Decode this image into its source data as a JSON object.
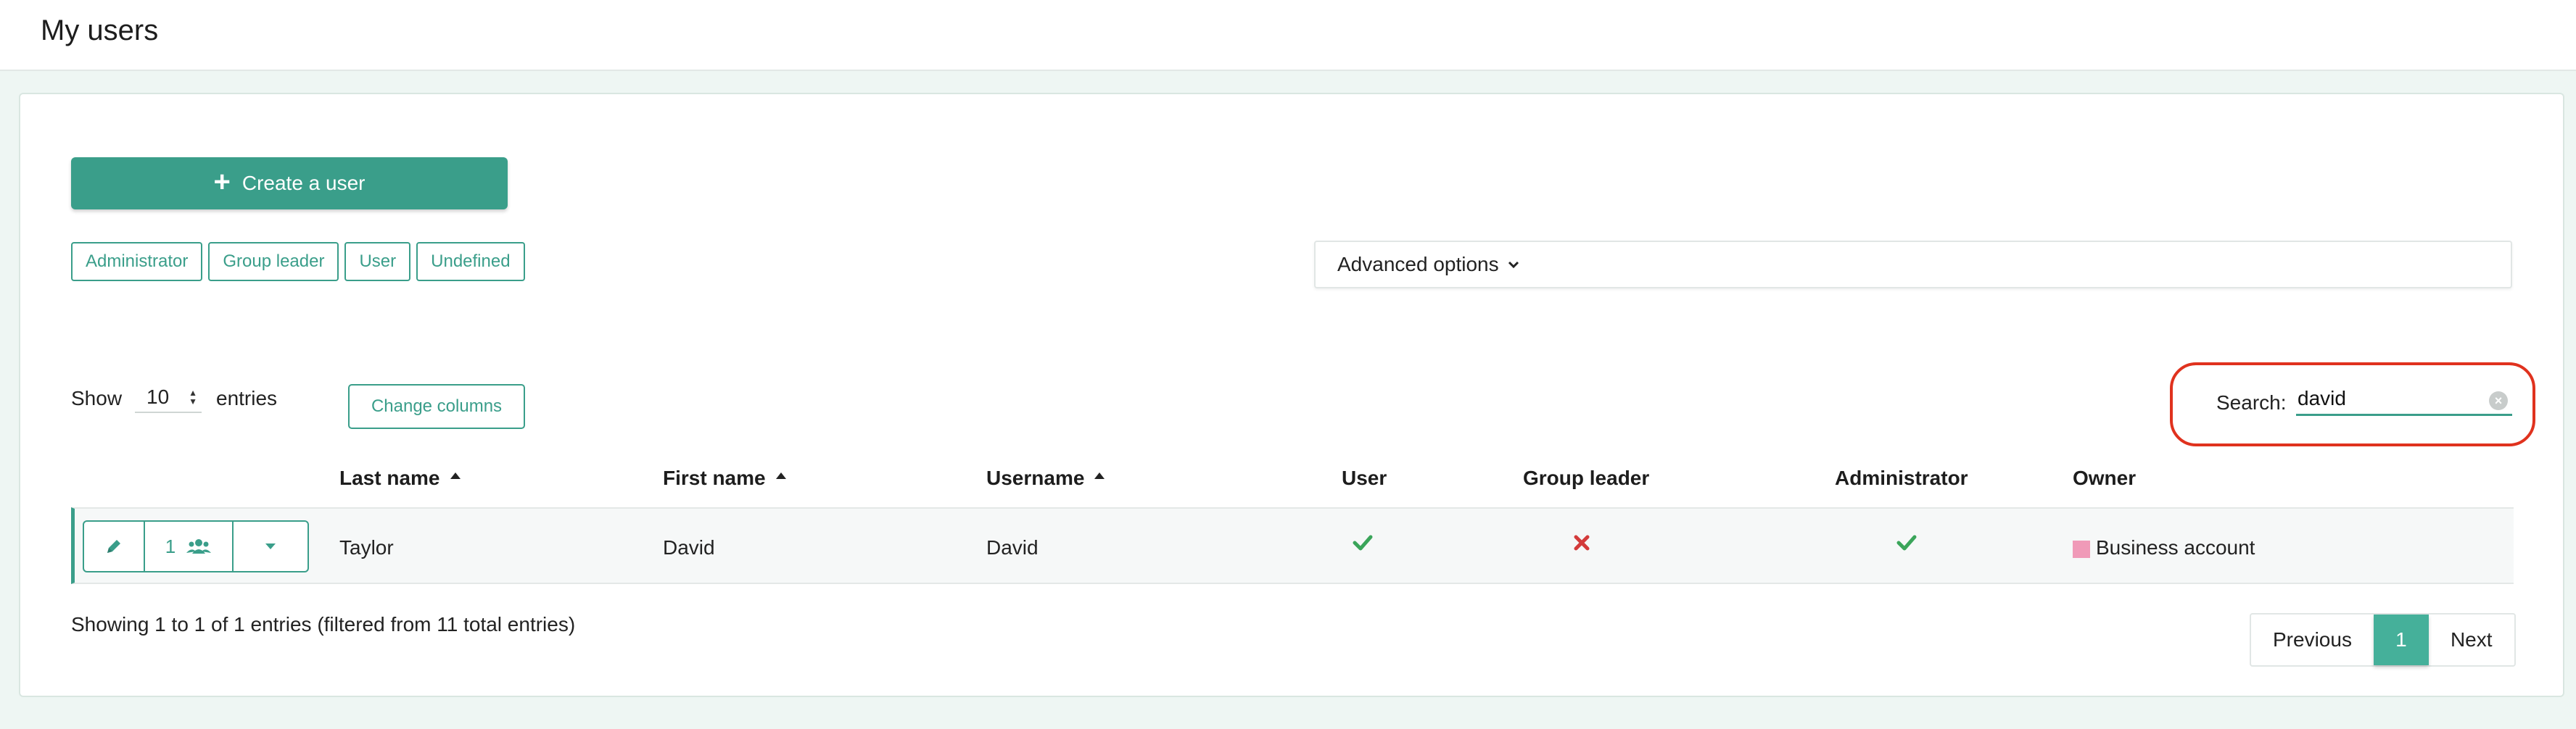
{
  "page": {
    "title": "My users"
  },
  "toolbar": {
    "create_label": "Create a user"
  },
  "filters": [
    "Administrator",
    "Group leader",
    "User",
    "Undefined"
  ],
  "advanced": {
    "label": "Advanced options"
  },
  "length": {
    "show": "Show",
    "value": "10",
    "entries": "entries"
  },
  "change_columns": "Change columns",
  "search": {
    "label": "Search:",
    "value": "david"
  },
  "table": {
    "headers": [
      "Last name",
      "First name",
      "Username",
      "User",
      "Group leader",
      "Administrator",
      "Owner"
    ],
    "rows": [
      {
        "group_count": "1",
        "last_name": "Taylor",
        "first_name": "David",
        "username": "David",
        "user": "check",
        "group_leader": "cross",
        "administrator": "check",
        "owner": "Business account"
      }
    ]
  },
  "info": "Showing 1 to 1 of 1 entries (filtered from 11 total entries)",
  "pagination": {
    "previous": "Previous",
    "current": "1",
    "next": "Next"
  },
  "colors": {
    "accent": "#3a9e8a",
    "check": "#3aa55a",
    "cross": "#d33b3b",
    "highlight": "#e0321e",
    "owner_swatch": "#f09ab8"
  }
}
